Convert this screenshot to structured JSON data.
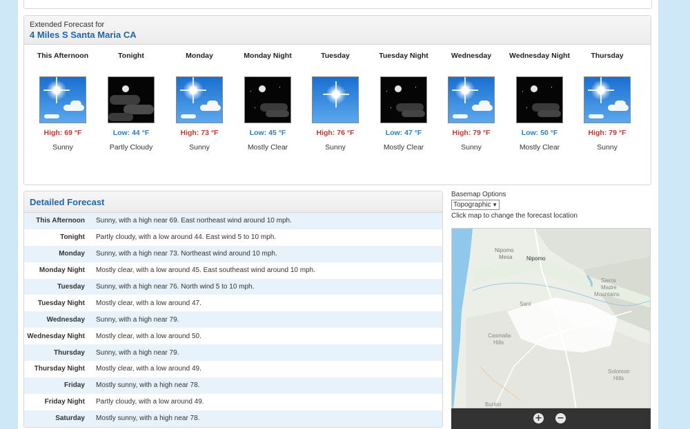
{
  "extended": {
    "header_small": "Extended Forecast for",
    "location": "4 Miles S Santa Maria CA",
    "periods": [
      {
        "name": "This Afternoon",
        "temp": "High: 69 °F",
        "desc": "Sunny",
        "kind": "day",
        "icon": "sunny-icon"
      },
      {
        "name": "Tonight",
        "temp": "Low: 44 °F",
        "desc": "Partly Cloudy",
        "kind": "night",
        "icon": "partly-cloudy-night-icon"
      },
      {
        "name": "Monday",
        "temp": "High: 73 °F",
        "desc": "Sunny",
        "kind": "day",
        "icon": "sunny-icon"
      },
      {
        "name": "Monday Night",
        "temp": "Low: 45 °F",
        "desc": "Mostly Clear",
        "kind": "night",
        "icon": "mostly-clear-night-icon"
      },
      {
        "name": "Tuesday",
        "temp": "High: 76 °F",
        "desc": "Sunny",
        "kind": "day",
        "icon": "sunny-icon"
      },
      {
        "name": "Tuesday Night",
        "temp": "Low: 47 °F",
        "desc": "Mostly Clear",
        "kind": "night",
        "icon": "mostly-clear-night-icon"
      },
      {
        "name": "Wednesday",
        "temp": "High: 79 °F",
        "desc": "Sunny",
        "kind": "day",
        "icon": "sunny-icon"
      },
      {
        "name": "Wednesday Night",
        "temp": "Low: 50 °F",
        "desc": "Mostly Clear",
        "kind": "night",
        "icon": "mostly-clear-night-icon"
      },
      {
        "name": "Thursday",
        "temp": "High: 79 °F",
        "desc": "Sunny",
        "kind": "day",
        "icon": "sunny-icon"
      }
    ]
  },
  "detailed": {
    "title": "Detailed Forecast",
    "rows": [
      {
        "label": "This Afternoon",
        "text": "Sunny, with a high near 69. East northeast wind around 10 mph."
      },
      {
        "label": "Tonight",
        "text": "Partly cloudy, with a low around 44. East wind 5 to 10 mph."
      },
      {
        "label": "Monday",
        "text": "Sunny, with a high near 73. Northeast wind around 10 mph."
      },
      {
        "label": "Monday Night",
        "text": "Mostly clear, with a low around 45. East southeast wind around 10 mph."
      },
      {
        "label": "Tuesday",
        "text": "Sunny, with a high near 76. North wind 5 to 10 mph."
      },
      {
        "label": "Tuesday Night",
        "text": "Mostly clear, with a low around 47."
      },
      {
        "label": "Wednesday",
        "text": "Sunny, with a high near 79."
      },
      {
        "label": "Wednesday Night",
        "text": "Mostly clear, with a low around 50."
      },
      {
        "label": "Thursday",
        "text": "Sunny, with a high near 79."
      },
      {
        "label": "Thursday Night",
        "text": "Mostly clear, with a low around 49."
      },
      {
        "label": "Friday",
        "text": "Mostly sunny, with a high near 78."
      },
      {
        "label": "Friday Night",
        "text": "Partly cloudy, with a low around 49."
      },
      {
        "label": "Saturday",
        "text": "Mostly sunny, with a high near 78."
      }
    ]
  },
  "basemap": {
    "title": "Basemap Options",
    "selected": "Topographic",
    "note": "Click map to change the forecast location"
  },
  "map": {
    "labels": {
      "nipomo_mesa_1": "Nipomo",
      "nipomo_mesa_2": "Mesa",
      "nipomo": "Nipomo",
      "santa": "Sant",
      "sierra_1": "Sierra",
      "sierra_2": "Madre",
      "sierra_3": "Mountains",
      "casmalia_1": "Casmalia",
      "casmalia_2": "Hills",
      "solomon_1": "Solomon",
      "solomon_2": "Hills",
      "burton": "Burton"
    },
    "zoom_in": "+",
    "zoom_out": "−"
  },
  "colors": {
    "accent": "#2266aa",
    "high_temp": "#c0392b",
    "low_temp": "#2a7fc1",
    "ocean": "#8fc8ea",
    "page_bg": "#cfe8f7"
  }
}
